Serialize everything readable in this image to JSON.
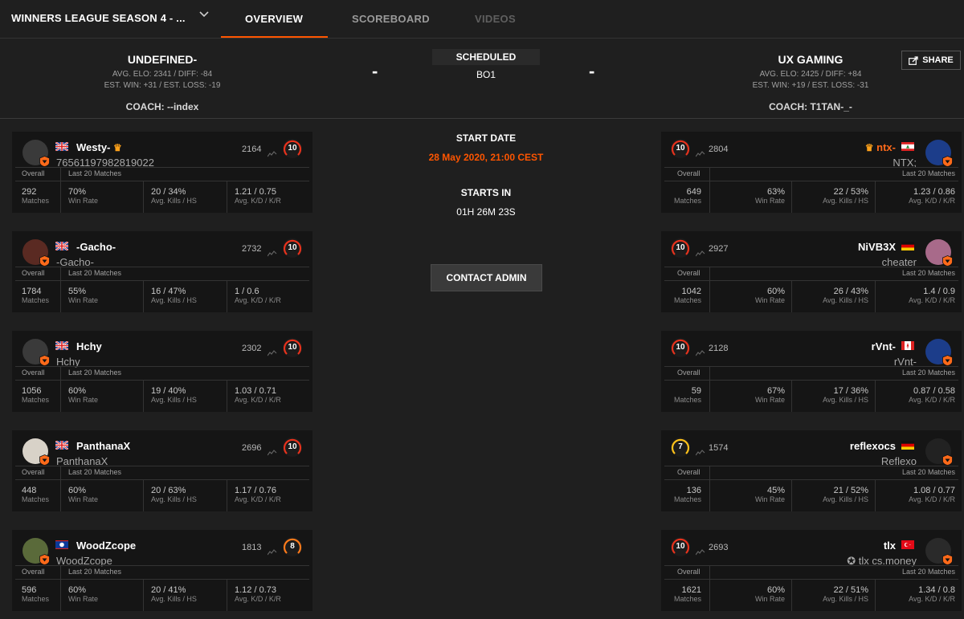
{
  "nav": {
    "title": "WINNERS LEAGUE SEASON 4 - ...",
    "tabs": [
      "OVERVIEW",
      "SCOREBOARD",
      "VIDEOS"
    ]
  },
  "match": {
    "team1": {
      "name": "UNDEFINED-",
      "elo": "AVG. ELO: 2341 / DIFF: -84",
      "est": "EST. WIN: +31 / EST. LOSS: -19",
      "coach": "COACH: --index"
    },
    "team2": {
      "name": "UX GAMING",
      "elo": "AVG. ELO: 2425 / DIFF: +84",
      "est": "EST. WIN: +19 / EST. LOSS: -31",
      "coach": "COACH: T1TAN-_-"
    },
    "dash": "-",
    "status": "SCHEDULED",
    "format": "BO1",
    "share": "SHARE"
  },
  "info": {
    "start_label": "START DATE",
    "start_date": "28 May 2020, 21:00 CEST",
    "starts_in_label": "STARTS IN",
    "starts_in": "01H 26M 23S",
    "contact": "CONTACT ADMIN"
  },
  "labels": {
    "overall": "Overall",
    "last20": "Last 20 Matches",
    "matches": "Matches",
    "winrate": "Win Rate",
    "kills": "Avg. Kills / HS",
    "kd": "Avg. K/D / K/R"
  },
  "left": [
    {
      "name": "Westy-",
      "sub": "76561197982819022",
      "elo": "2164",
      "level": "10",
      "matches": "292",
      "win": "70%",
      "kills": "20 / 34%",
      "kd": "1.21 / 0.75",
      "crown": "♛"
    },
    {
      "name": "-Gacho-",
      "sub": "-Gacho-",
      "elo": "2732",
      "level": "10",
      "matches": "1784",
      "win": "55%",
      "kills": "16 / 47%",
      "kd": "1 / 0.6"
    },
    {
      "name": "Hchy",
      "sub": "Hchy",
      "elo": "2302",
      "level": "10",
      "matches": "1056",
      "win": "60%",
      "kills": "19 / 40%",
      "kd": "1.03 / 0.71"
    },
    {
      "name": "PanthanaX",
      "sub": "PanthanaX",
      "elo": "2696",
      "level": "10",
      "matches": "448",
      "win": "60%",
      "kills": "20 / 63%",
      "kd": "1.17 / 0.76"
    },
    {
      "name": "WoodZcope",
      "sub": "WoodZcope",
      "elo": "1813",
      "level": "8",
      "matches": "596",
      "win": "60%",
      "kills": "20 / 41%",
      "kd": "1.12 / 0.73"
    }
  ],
  "right": [
    {
      "name": "ntx-",
      "sub": "NTX;",
      "elo": "2804",
      "level": "10",
      "matches": "649",
      "win": "63%",
      "kills": "22 / 53%",
      "kd": "1.23 / 0.86",
      "crown": "♛"
    },
    {
      "name": "NiVB3X",
      "sub": "cheater",
      "elo": "2927",
      "level": "10",
      "matches": "1042",
      "win": "60%",
      "kills": "26 / 43%",
      "kd": "1.4 / 0.9"
    },
    {
      "name": "rVnt-",
      "sub": "rVnt-",
      "elo": "2128",
      "level": "10",
      "matches": "59",
      "win": "67%",
      "kills": "17 / 36%",
      "kd": "0.87 / 0.58"
    },
    {
      "name": "reflexocs",
      "sub": "Reflexo",
      "elo": "1574",
      "level": "7",
      "matches": "136",
      "win": "45%",
      "kills": "21 / 52%",
      "kd": "1.08 / 0.77"
    },
    {
      "name": "tlx",
      "sub": "✪ tlx cs.money",
      "elo": "2693",
      "level": "10",
      "matches": "1621",
      "win": "60%",
      "kills": "22 / 51%",
      "kd": "1.34 / 0.8"
    }
  ],
  "colors": {
    "accent": "#ff5500",
    "level10": "#e8321c",
    "level8": "#ff7a1a",
    "level7": "#ffc21a"
  },
  "icons": {
    "chevron": "chevron-down-icon",
    "share": "share-icon",
    "trend": "trend-icon",
    "badge": "faceit-badge-icon"
  }
}
